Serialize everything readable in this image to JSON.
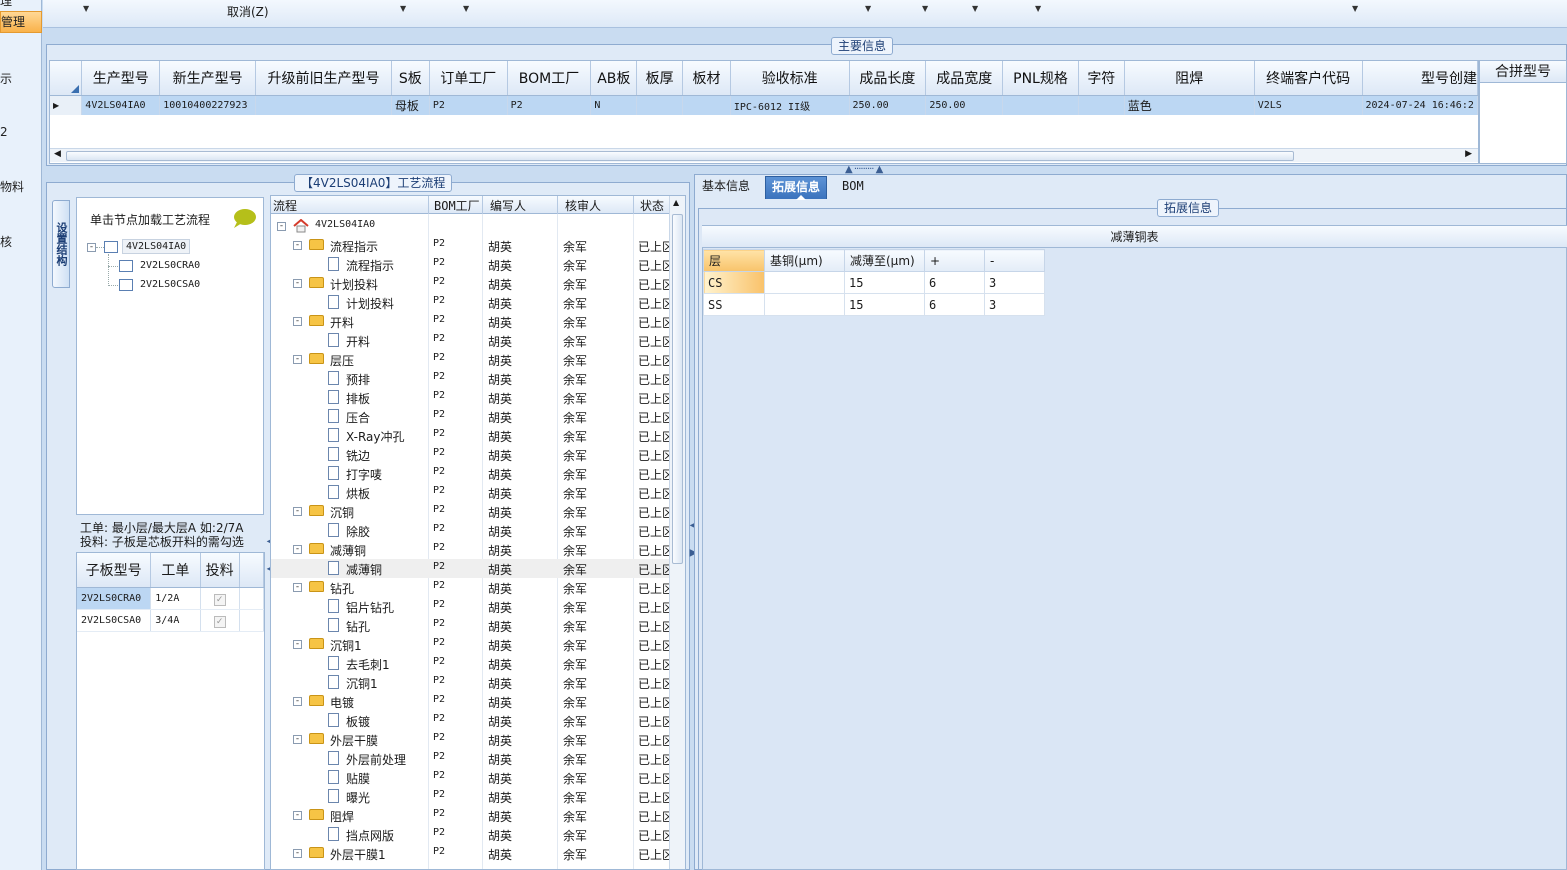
{
  "leftnav": {
    "items": [
      {
        "label": "理",
        "active": false
      },
      {
        "label": "管理",
        "active": true
      },
      {
        "label": "示",
        "active": false
      },
      {
        "label": "2",
        "active": false
      },
      {
        "label": "物料",
        "active": false
      },
      {
        "label": "核",
        "active": false
      }
    ]
  },
  "toolbar": {
    "cancel_label": "取消(Z)",
    "dropdown_icon": "triangle-down"
  },
  "main_info": {
    "title": "主要信息",
    "columns": [
      "生产型号",
      "新生产型号",
      "升级前旧生产型号",
      "S板",
      "订单工厂",
      "BOM工厂",
      "AB板",
      "板厚",
      "板材",
      "验收标准",
      "成品长度",
      "成品宽度",
      "PNL规格",
      "字符",
      "阻焊",
      "终端客户代码",
      "型号创建"
    ],
    "rows": [
      [
        "4V2LS04IA0",
        "10010400227923",
        "",
        "母板",
        "P2",
        "P2",
        "N",
        "",
        "",
        "IPC-6012 II级",
        "250.00",
        "250.00",
        "",
        "",
        "蓝色",
        "V2LS",
        "2024-07-24 16:46:2"
      ]
    ],
    "merge_panel_title": "合拼型号"
  },
  "process_flow": {
    "title": "【4V2LS04IA0】工艺流程",
    "vertical_tab": "设置结构",
    "structure_hint": "单击节点加载工艺流程",
    "structure_tree": {
      "root": "4V2LS04IA0",
      "children": [
        "2V2LS0CRA0",
        "2V2LS0CSA0"
      ]
    },
    "layer_note_line1": "工单: 最小层/最大层A 如:2/7A",
    "layer_note_line2": "投料: 子板是芯板开料的需勾选",
    "sub_board": {
      "columns": [
        "子板型号",
        "工单",
        "投料"
      ],
      "rows": [
        {
          "model": "2V2LS0CRA0",
          "order": "1/2A",
          "checked": true
        },
        {
          "model": "2V2LS0CSA0",
          "order": "3/4A",
          "checked": true
        }
      ]
    },
    "grid": {
      "columns": [
        "流程",
        "BOM工厂",
        "编写人",
        "核审人",
        "状态"
      ],
      "root": "4V2LS04IA0",
      "rows": [
        {
          "level": 1,
          "name": "流程指示",
          "factory": "P2",
          "writer": "胡英",
          "reviewer": "余军",
          "status": "已上区"
        },
        {
          "level": 2,
          "name": "流程指示",
          "factory": "P2",
          "writer": "胡英",
          "reviewer": "余军",
          "status": "已上区"
        },
        {
          "level": 1,
          "name": "计划投料",
          "factory": "P2",
          "writer": "胡英",
          "reviewer": "余军",
          "status": "已上区"
        },
        {
          "level": 2,
          "name": "计划投料",
          "factory": "P2",
          "writer": "胡英",
          "reviewer": "余军",
          "status": "已上区"
        },
        {
          "level": 1,
          "name": "开料",
          "factory": "P2",
          "writer": "胡英",
          "reviewer": "余军",
          "status": "已上区"
        },
        {
          "level": 2,
          "name": "开料",
          "factory": "P2",
          "writer": "胡英",
          "reviewer": "余军",
          "status": "已上区"
        },
        {
          "level": 1,
          "name": "层压",
          "factory": "P2",
          "writer": "胡英",
          "reviewer": "余军",
          "status": "已上区"
        },
        {
          "level": 2,
          "name": "预排",
          "factory": "P2",
          "writer": "胡英",
          "reviewer": "余军",
          "status": "已上区"
        },
        {
          "level": 2,
          "name": "排板",
          "factory": "P2",
          "writer": "胡英",
          "reviewer": "余军",
          "status": "已上区"
        },
        {
          "level": 2,
          "name": "压合",
          "factory": "P2",
          "writer": "胡英",
          "reviewer": "余军",
          "status": "已上区"
        },
        {
          "level": 2,
          "name": "X-Ray冲孔",
          "factory": "P2",
          "writer": "胡英",
          "reviewer": "余军",
          "status": "已上区"
        },
        {
          "level": 2,
          "name": "铣边",
          "factory": "P2",
          "writer": "胡英",
          "reviewer": "余军",
          "status": "已上区"
        },
        {
          "level": 2,
          "name": "打字唛",
          "factory": "P2",
          "writer": "胡英",
          "reviewer": "余军",
          "status": "已上区"
        },
        {
          "level": 2,
          "name": "烘板",
          "factory": "P2",
          "writer": "胡英",
          "reviewer": "余军",
          "status": "已上区"
        },
        {
          "level": 1,
          "name": "沉铜",
          "factory": "P2",
          "writer": "胡英",
          "reviewer": "余军",
          "status": "已上区"
        },
        {
          "level": 2,
          "name": "除胶",
          "factory": "P2",
          "writer": "胡英",
          "reviewer": "余军",
          "status": "已上区"
        },
        {
          "level": 1,
          "name": "减薄铜",
          "factory": "P2",
          "writer": "胡英",
          "reviewer": "余军",
          "status": "已上区"
        },
        {
          "level": 2,
          "name": "减薄铜",
          "factory": "P2",
          "writer": "胡英",
          "reviewer": "余军",
          "status": "已上区",
          "selected": true
        },
        {
          "level": 1,
          "name": "钻孔",
          "factory": "P2",
          "writer": "胡英",
          "reviewer": "余军",
          "status": "已上区"
        },
        {
          "level": 2,
          "name": "铝片钻孔",
          "factory": "P2",
          "writer": "胡英",
          "reviewer": "余军",
          "status": "已上区"
        },
        {
          "level": 2,
          "name": "钻孔",
          "factory": "P2",
          "writer": "胡英",
          "reviewer": "余军",
          "status": "已上区"
        },
        {
          "level": 1,
          "name": "沉铜1",
          "factory": "P2",
          "writer": "胡英",
          "reviewer": "余军",
          "status": "已上区"
        },
        {
          "level": 2,
          "name": "去毛刺1",
          "factory": "P2",
          "writer": "胡英",
          "reviewer": "余军",
          "status": "已上区"
        },
        {
          "level": 2,
          "name": "沉铜1",
          "factory": "P2",
          "writer": "胡英",
          "reviewer": "余军",
          "status": "已上区"
        },
        {
          "level": 1,
          "name": "电镀",
          "factory": "P2",
          "writer": "胡英",
          "reviewer": "余军",
          "status": "已上区"
        },
        {
          "level": 2,
          "name": "板镀",
          "factory": "P2",
          "writer": "胡英",
          "reviewer": "余军",
          "status": "已上区"
        },
        {
          "level": 1,
          "name": "外层干膜",
          "factory": "P2",
          "writer": "胡英",
          "reviewer": "余军",
          "status": "已上区"
        },
        {
          "level": 2,
          "name": "外层前处理",
          "factory": "P2",
          "writer": "胡英",
          "reviewer": "余军",
          "status": "已上区"
        },
        {
          "level": 2,
          "name": "贴膜",
          "factory": "P2",
          "writer": "胡英",
          "reviewer": "余军",
          "status": "已上区"
        },
        {
          "level": 2,
          "name": "曝光",
          "factory": "P2",
          "writer": "胡英",
          "reviewer": "余军",
          "status": "已上区"
        },
        {
          "level": 1,
          "name": "阻焊",
          "factory": "P2",
          "writer": "胡英",
          "reviewer": "余军",
          "status": "已上区"
        },
        {
          "level": 2,
          "name": "挡点网版",
          "factory": "P2",
          "writer": "胡英",
          "reviewer": "余军",
          "status": "已上区"
        },
        {
          "level": 1,
          "name": "外层干膜1",
          "factory": "P2",
          "writer": "胡英",
          "reviewer": "余军",
          "status": "已上区"
        }
      ]
    }
  },
  "right_tabs": {
    "tabs": [
      {
        "label": "基本信息",
        "active": false
      },
      {
        "label": "拓展信息",
        "active": true
      },
      {
        "label": "BOM",
        "active": false
      }
    ],
    "group_title": "拓展信息",
    "table_caption": "减薄铜表",
    "table": {
      "columns": [
        "层",
        "基铜(μm)",
        "减薄至(μm)",
        "+",
        "-"
      ],
      "rows": [
        [
          "CS",
          "",
          "15",
          "6",
          "3"
        ],
        [
          "SS",
          "",
          "15",
          "6",
          "3"
        ]
      ]
    }
  },
  "colors": {
    "selected_row": "#bcd7f3",
    "tab_active": "#3b73bd",
    "panel_bg": "#dfeaf7"
  }
}
